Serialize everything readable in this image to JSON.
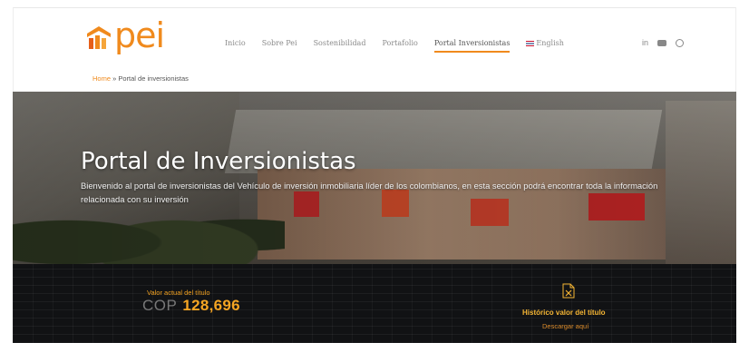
{
  "brand": {
    "logo_text": "pei",
    "accent": "#f08a1d"
  },
  "nav": {
    "items": [
      {
        "label": "Inicio",
        "active": false
      },
      {
        "label": "Sobre Pei",
        "active": false
      },
      {
        "label": "Sostenibilidad",
        "active": false
      },
      {
        "label": "Portafolio",
        "active": false
      },
      {
        "label": "Portal Inversionistas",
        "active": true
      },
      {
        "label": "English",
        "active": false
      }
    ],
    "social": {
      "linkedin": "in"
    }
  },
  "breadcrumb": {
    "home": "Home",
    "separator": "»",
    "current": "Portal de inversionistas"
  },
  "hero": {
    "title": "Portal de Inversionistas",
    "description": "Bienvenido al portal de inversionistas del Vehículo de inversión inmobiliaria líder de los colombianos, en esta sección podrá encontrar toda la información relacionada con su inversión"
  },
  "stats": {
    "value_label": "Valor actual del título",
    "currency": "COP",
    "value": "128,696",
    "history_label": "Histórico valor del título",
    "download_label": "Descargar aquí"
  }
}
